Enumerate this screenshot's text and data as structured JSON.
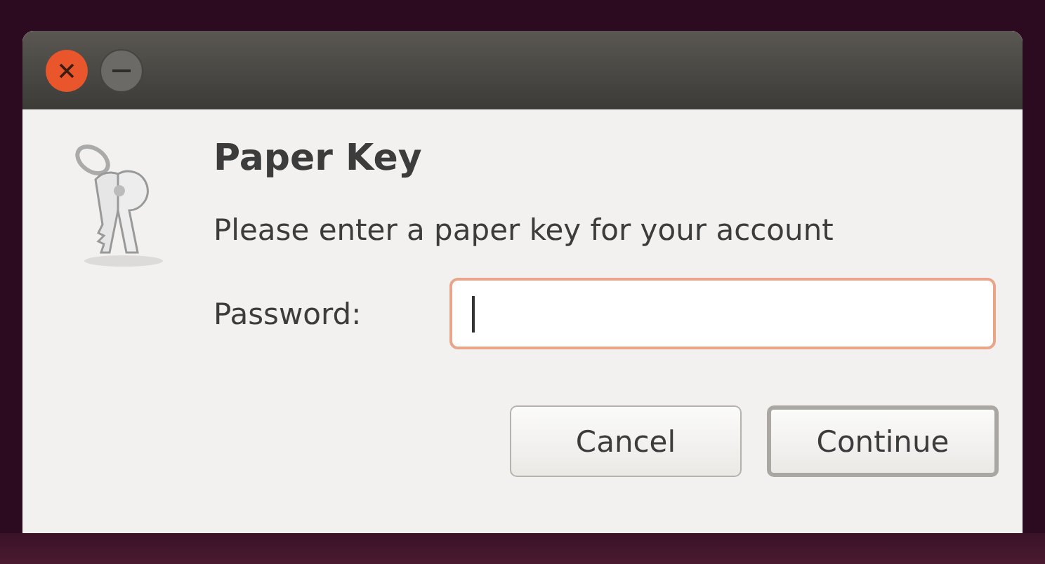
{
  "dialog": {
    "heading": "Paper Key",
    "message": "Please enter a paper key for your account",
    "field": {
      "label": "Password:",
      "focused": true
    },
    "buttons": [
      {
        "label": "Cancel",
        "default": false
      },
      {
        "label": "Continue",
        "default": true
      }
    ]
  }
}
